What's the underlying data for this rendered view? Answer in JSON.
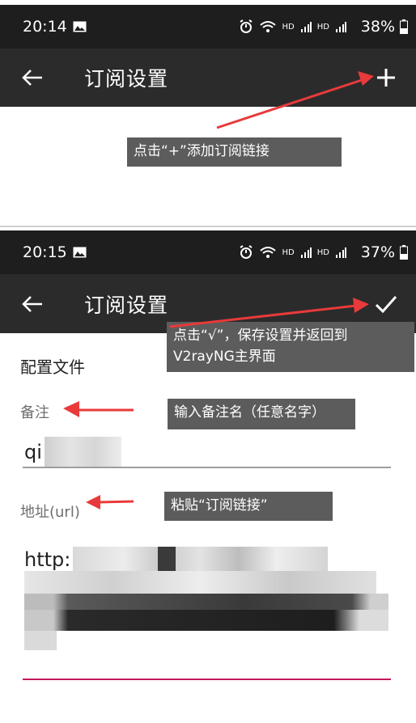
{
  "screen1": {
    "status": {
      "time": "20:14",
      "hd1": "HD",
      "hd2": "HD",
      "battery": "38%"
    },
    "appbar": {
      "title": "订阅设置"
    },
    "callout_add": "点击“+”添加订阅链接"
  },
  "screen2": {
    "status": {
      "time": "20:15",
      "hd1": "HD",
      "hd2": "HD",
      "battery": "37%"
    },
    "appbar": {
      "title": "订阅设置"
    },
    "callout_save": "点击“√”，保存设置并返回到V2rayNG主界面",
    "section_title": "配置文件",
    "remarks_label": "备注",
    "remarks_value": "qi",
    "callout_remarks": "输入备注名（任意名字）",
    "url_label": "地址(url)",
    "url_value": "http:",
    "callout_url": "粘贴“订阅链接”"
  },
  "colors": {
    "annotation_arrow": "#e83a3a",
    "status_bar": "#1e1e1e",
    "app_bar": "#2b2b2b",
    "callout_bg": "#5c5c5c",
    "focused_underline": "#c2185b"
  },
  "icons": [
    "image-icon",
    "alarm-icon",
    "wifi-call-icon",
    "signal-icon",
    "battery-icon",
    "back-arrow-icon",
    "plus-icon",
    "check-icon"
  ]
}
